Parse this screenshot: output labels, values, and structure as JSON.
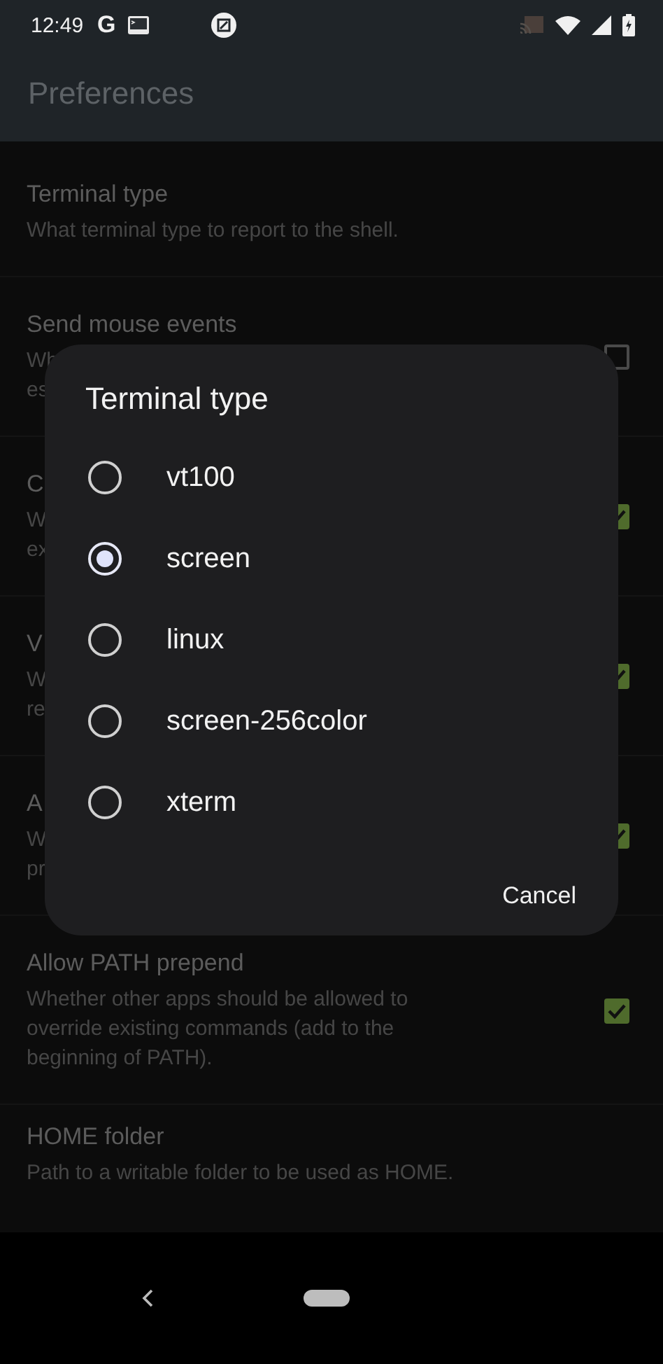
{
  "status_bar": {
    "time": "12:49",
    "app_letter": "G"
  },
  "app_bar": {
    "title": "Preferences"
  },
  "preferences": [
    {
      "kind": "plain",
      "title": "Terminal type",
      "summary": [
        "What terminal type to report to the shell."
      ]
    },
    {
      "kind": "checkbox",
      "title": "Send mouse events",
      "summary": [
        "Wh",
        "es"
      ],
      "checked": false
    },
    {
      "kind": "checkbox",
      "title": "C",
      "summary": [
        "W",
        "ex"
      ],
      "checked": true
    },
    {
      "kind": "checkbox",
      "title": "V",
      "summary": [
        "W",
        "re"
      ],
      "checked": true
    },
    {
      "kind": "checkbox",
      "title": "A",
      "summary": [
        "W",
        "pr"
      ],
      "checked": true
    },
    {
      "kind": "checkbox",
      "title": "Allow PATH prepend",
      "summary": [
        "Whether other apps should be allowed to",
        "override existing commands (add to the",
        "beginning of PATH)."
      ],
      "checked": true
    },
    {
      "kind": "plain",
      "title": "HOME folder",
      "summary": [
        "Path to a writable folder to be used as HOME."
      ]
    }
  ],
  "dialog": {
    "title": "Terminal type",
    "options": [
      {
        "label": "vt100",
        "selected": false
      },
      {
        "label": "screen",
        "selected": true
      },
      {
        "label": "linux",
        "selected": false
      },
      {
        "label": "screen-256color",
        "selected": false
      },
      {
        "label": "xterm",
        "selected": false
      }
    ],
    "buttons": [
      "Cancel"
    ]
  }
}
